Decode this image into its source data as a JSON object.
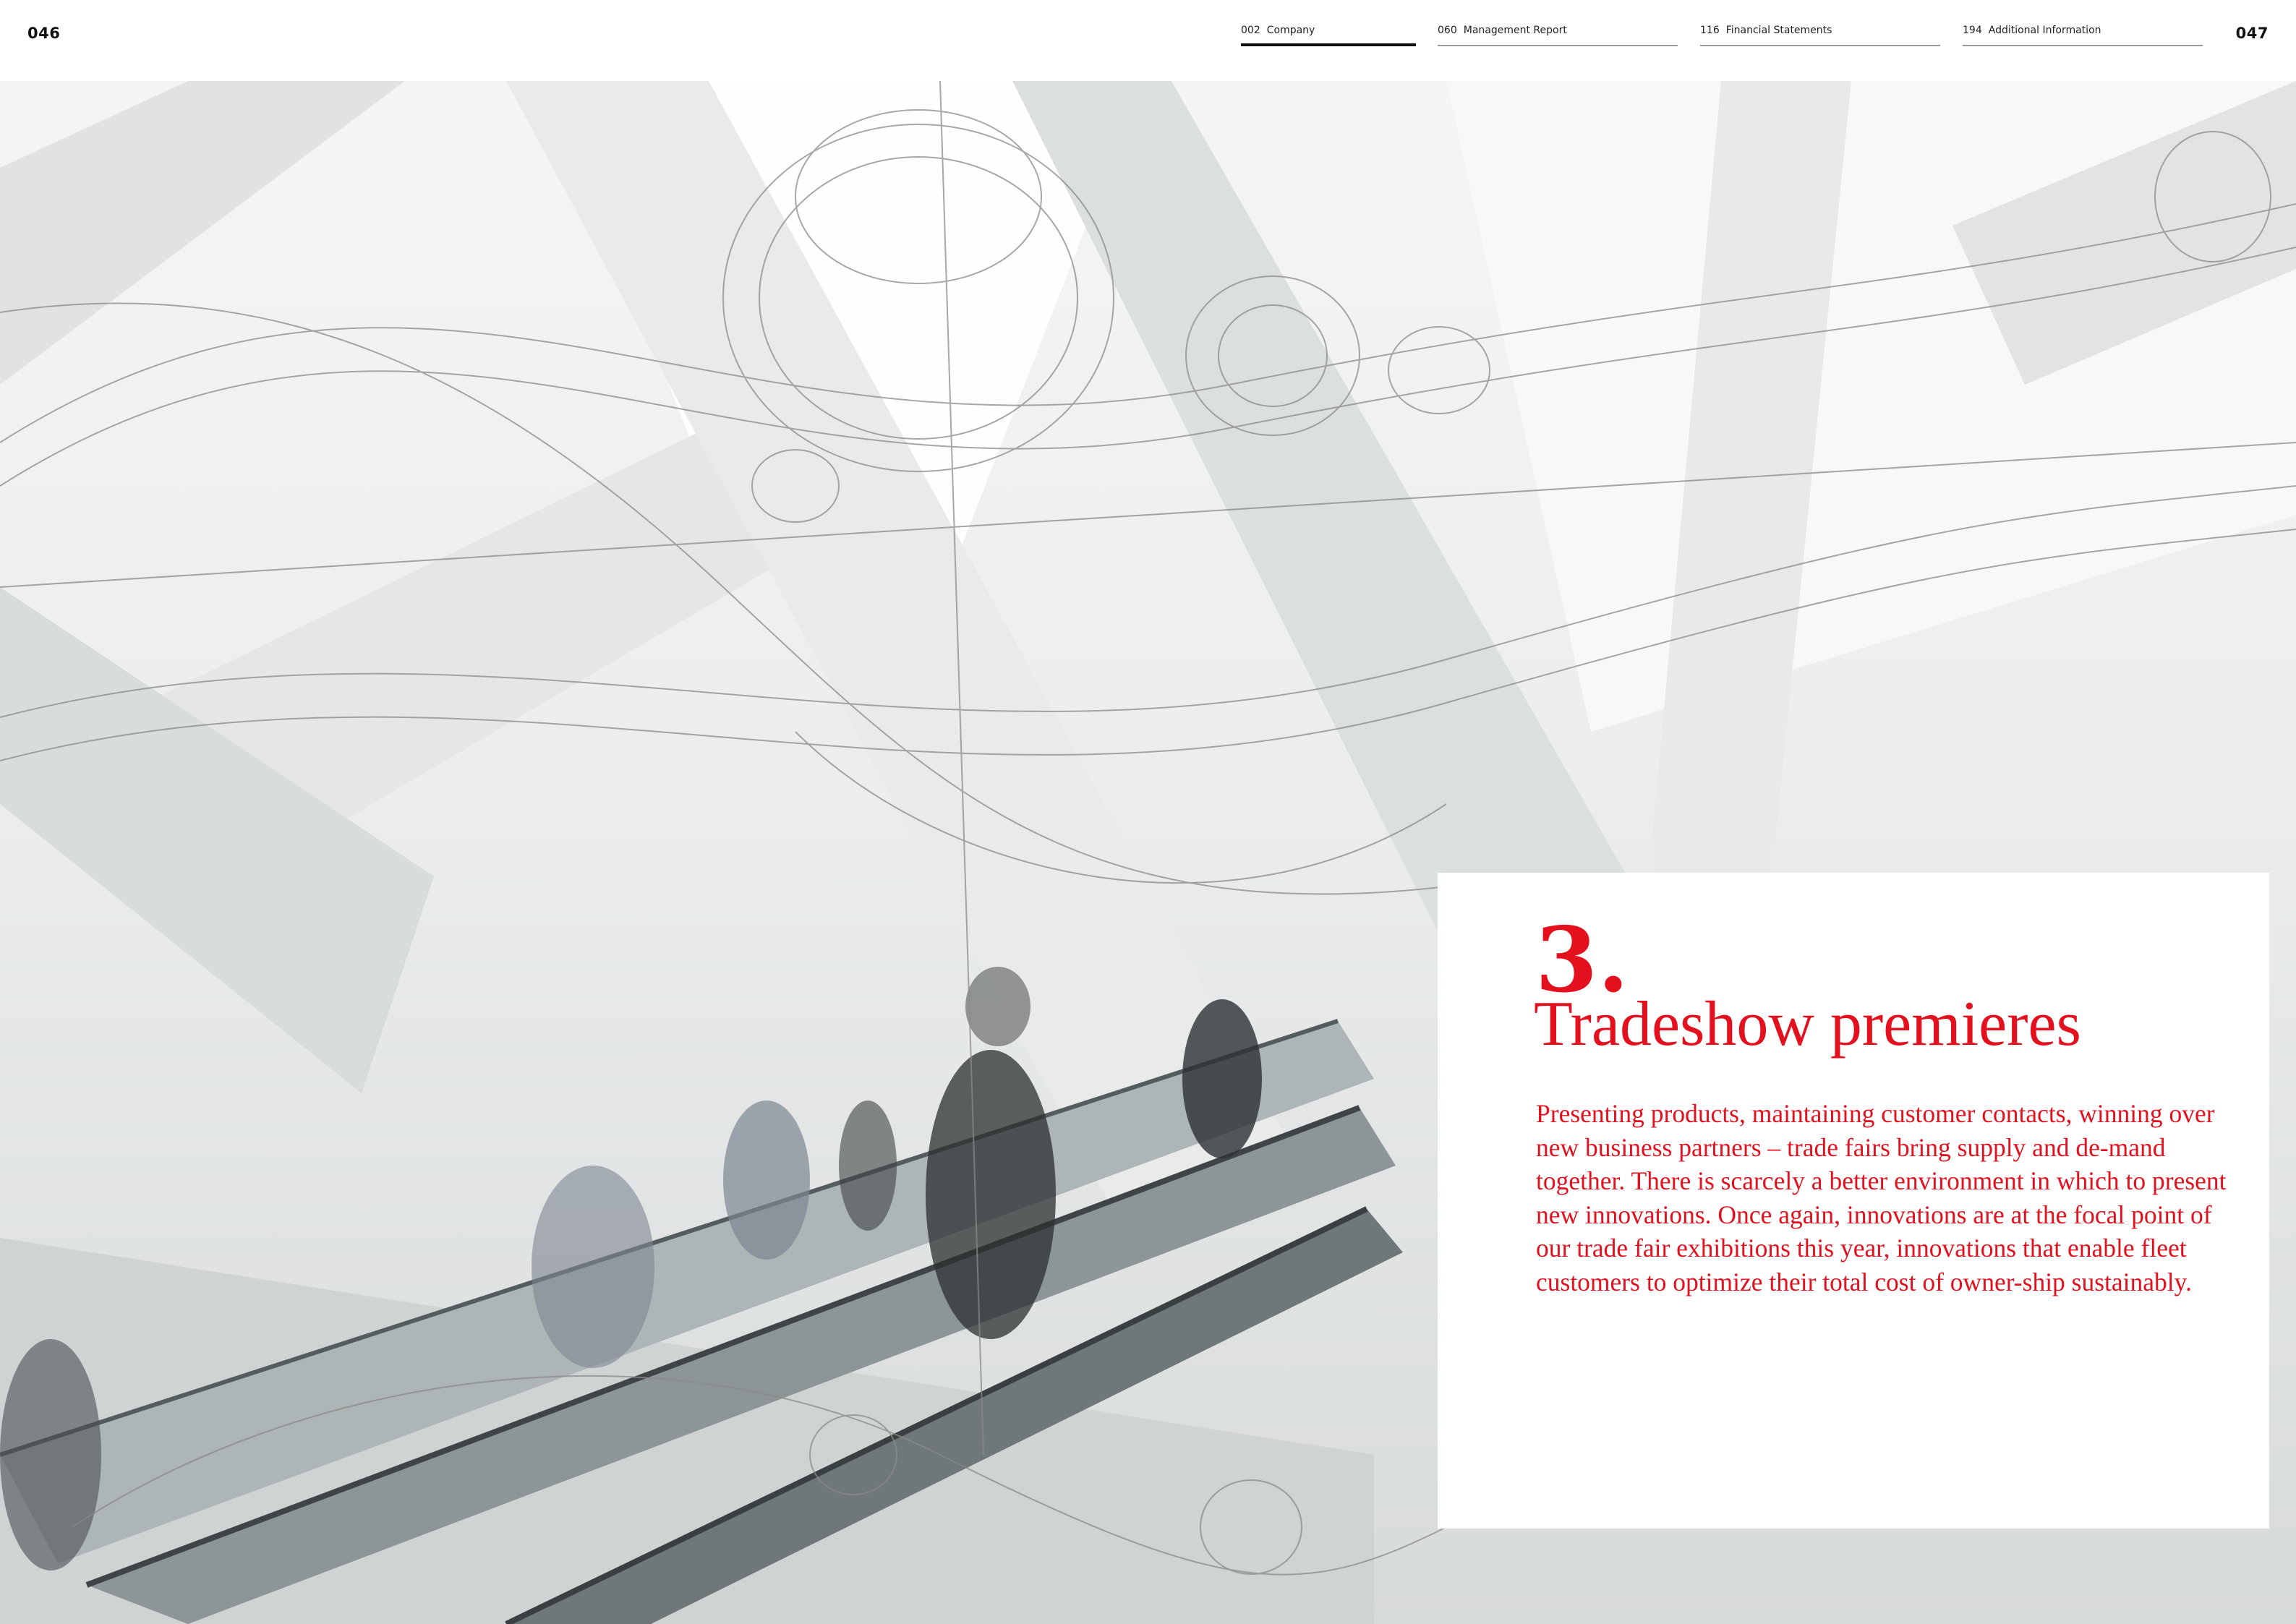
{
  "header": {
    "page_left": "046",
    "page_right": "047",
    "tabs": [
      {
        "number": "002",
        "label": "Company",
        "active": true
      },
      {
        "number": "060",
        "label": "Management Report",
        "active": false
      },
      {
        "number": "116",
        "label": "Financial Statements",
        "active": false
      },
      {
        "number": "194",
        "label": "Additional Information",
        "active": false
      }
    ]
  },
  "section": {
    "number": "3.",
    "title": "Tradeshow premieres",
    "body": "Presenting products, maintaining customer contacts, winning over new business partners – trade fairs bring supply and de-mand together. There is scarcely a better environment in which to present new innovations. Once again, innovations are at the focal point of our trade fair exhibitions this year, innovations that enable fleet customers to optimize their total cost of owner-ship sustainably."
  },
  "colors": {
    "accent": "#e3101e",
    "nav_text": "#222222",
    "background": "#ffffff"
  }
}
